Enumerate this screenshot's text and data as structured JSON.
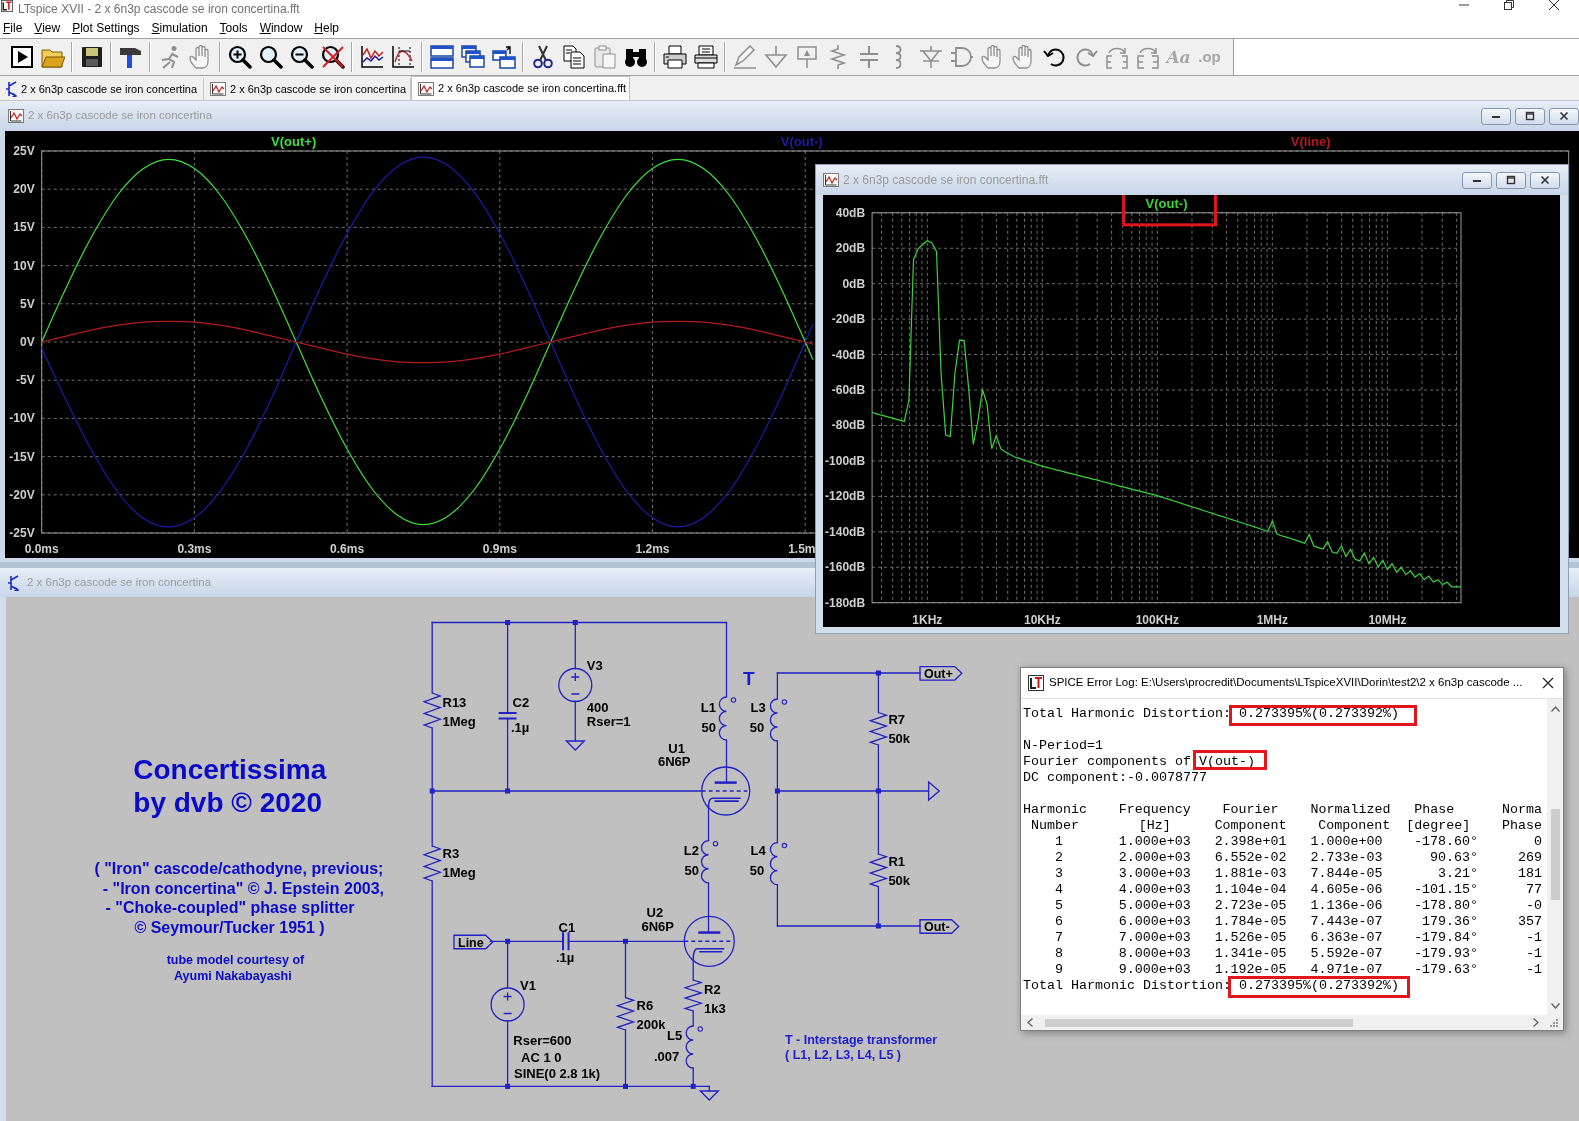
{
  "app_title": "LTspice XVII - 2 x 6n3p cascode se iron concertina.fft",
  "menu": [
    "File",
    "View",
    "Plot Settings",
    "Simulation",
    "Tools",
    "Window",
    "Help"
  ],
  "toolbar": [
    [
      {
        "kind": "run",
        "disabled": false
      },
      {
        "kind": "open",
        "disabled": false
      }
    ],
    [
      {
        "kind": "save",
        "disabled": false
      }
    ],
    [
      {
        "kind": "hammer",
        "disabled": false
      }
    ],
    [
      {
        "kind": "halt",
        "disabled": true
      },
      {
        "kind": "pan",
        "disabled": true
      }
    ],
    [
      {
        "kind": "zoom_in",
        "disabled": false
      },
      {
        "kind": "zoom_fit",
        "disabled": false
      },
      {
        "kind": "zoom_out",
        "disabled": false
      },
      {
        "kind": "zoom_cancel",
        "disabled": false
      }
    ],
    [
      {
        "kind": "autorange",
        "disabled": false
      },
      {
        "kind": "mark",
        "disabled": false
      }
    ],
    [
      {
        "kind": "tile",
        "disabled": false
      },
      {
        "kind": "cascade",
        "disabled": false
      },
      {
        "kind": "arrange",
        "disabled": false
      }
    ],
    [
      {
        "kind": "cut",
        "disabled": false
      },
      {
        "kind": "copy",
        "disabled": false
      },
      {
        "kind": "paste",
        "disabled": true
      },
      {
        "kind": "find",
        "disabled": false
      }
    ],
    [
      {
        "kind": "print",
        "disabled": false
      },
      {
        "kind": "print_setup",
        "disabled": false
      }
    ],
    [
      {
        "kind": "wire",
        "disabled": true
      },
      {
        "kind": "ground",
        "disabled": true
      },
      {
        "kind": "label",
        "disabled": true
      },
      {
        "kind": "resistor",
        "disabled": true
      },
      {
        "kind": "capacitor",
        "disabled": true
      },
      {
        "kind": "inductor",
        "disabled": true
      },
      {
        "kind": "diode",
        "disabled": true
      },
      {
        "kind": "component",
        "disabled": true
      },
      {
        "kind": "move",
        "disabled": true
      },
      {
        "kind": "drag",
        "disabled": true
      },
      {
        "kind": "undo",
        "disabled": false
      },
      {
        "kind": "redo",
        "disabled": true
      },
      {
        "kind": "rotate",
        "disabled": true
      },
      {
        "kind": "mirror",
        "disabled": true
      },
      {
        "kind": "text",
        "glyph": "Aa",
        "disabled": true
      },
      {
        "kind": "spice",
        "glyph": ".op",
        "disabled": true
      }
    ]
  ],
  "tabs": [
    {
      "kind": "schematic",
      "label": "2 x 6n3p cascode se iron concertina",
      "selected": false
    },
    {
      "kind": "waveform",
      "label": "2 x 6n3p cascode se iron concertina",
      "selected": false
    },
    {
      "kind": "waveform",
      "label": "2 x 6n3p cascode se iron concertina.fft",
      "selected": true
    }
  ],
  "waveform_window": {
    "title": "2 x 6n3p cascode se iron concertina",
    "chart_data": {
      "type": "line",
      "grid": true,
      "x": [
        0,
        0.05,
        0.1,
        0.15,
        0.2,
        0.25,
        0.3,
        0.35,
        0.4,
        0.45,
        0.5,
        0.55,
        0.6,
        0.65,
        0.7,
        0.75,
        0.8,
        0.85,
        0.9,
        0.95,
        1,
        1.05,
        1.1,
        1.15,
        1.2,
        1.25,
        1.3,
        1.35,
        1.4,
        1.45,
        1.5,
        1.515
      ],
      "series": [
        {
          "name": "V(out+)",
          "color": "#3ee03e",
          "values": [
            0,
            7.4,
            14,
            19.3,
            22.7,
            23.9,
            22.7,
            19.3,
            14,
            7.4,
            0,
            -7.4,
            -14,
            -19.3,
            -22.7,
            -23.9,
            -22.7,
            -19.3,
            -14,
            -7.4,
            0,
            7.4,
            14,
            19.3,
            22.7,
            23.9,
            22.7,
            19.3,
            14,
            7.4,
            0,
            -2.3
          ]
        },
        {
          "name": "V(out-)",
          "color": "#1c1ca8",
          "values": [
            -0.8,
            -7.9,
            -14.4,
            -19.7,
            -23.1,
            -24.2,
            -23,
            -19.6,
            -14.3,
            -7.6,
            0,
            7.5,
            14.2,
            19.6,
            23,
            24.2,
            23,
            19.6,
            14.2,
            7.5,
            0,
            -7.5,
            -14.2,
            -19.6,
            -23,
            -24.2,
            -23,
            -19.6,
            -14.2,
            -7.5,
            0,
            2.3
          ]
        },
        {
          "name": "V(line)",
          "color": "#b41c1c",
          "values": [
            0,
            0.8,
            1.6,
            2.2,
            2.6,
            2.7,
            2.6,
            2.2,
            1.6,
            0.8,
            0,
            -0.8,
            -1.6,
            -2.2,
            -2.6,
            -2.7,
            -2.6,
            -2.2,
            -1.6,
            -0.8,
            0,
            0.8,
            1.6,
            2.2,
            2.6,
            2.7,
            2.6,
            2.2,
            1.6,
            0.8,
            0,
            -0.3
          ]
        }
      ],
      "xlim": [
        0,
        3
      ],
      "ylim": [
        -25,
        25
      ],
      "xticks": [
        {
          "value": 0,
          "label": "0.0ms"
        },
        {
          "value": 0.3,
          "label": "0.3ms"
        },
        {
          "value": 0.6,
          "label": "0.6ms"
        },
        {
          "value": 0.9,
          "label": "0.9ms"
        },
        {
          "value": 1.2,
          "label": "1.2ms"
        },
        {
          "value": 1.5,
          "label": "1.5m"
        }
      ],
      "yticks": [
        {
          "value": 25,
          "label": "25V"
        },
        {
          "value": 20,
          "label": "20V"
        },
        {
          "value": 15,
          "label": "15V"
        },
        {
          "value": 10,
          "label": "10V"
        },
        {
          "value": 5,
          "label": "5V"
        },
        {
          "value": 0,
          "label": "0V"
        },
        {
          "value": -5,
          "label": "-5V"
        },
        {
          "value": -10,
          "label": "-10V"
        },
        {
          "value": -15,
          "label": "-15V"
        },
        {
          "value": -20,
          "label": "-20V"
        },
        {
          "value": -25,
          "label": "-25V"
        }
      ]
    }
  },
  "fft_window": {
    "title": "2 x 6n3p cascode se iron concertina.fft",
    "label_highlighted": true,
    "chart_data": {
      "type": "line",
      "grid": true,
      "categories": [
        null,
        null,
        null,
        null,
        null,
        null,
        null,
        null,
        null,
        null,
        null,
        null,
        "1KHz",
        null,
        null,
        null,
        null,
        null,
        null,
        null,
        null,
        null,
        null,
        null,
        null,
        null,
        null,
        null,
        null,
        null,
        null,
        null,
        null,
        null,
        null,
        null,
        null,
        "10KHz",
        null,
        null,
        null,
        null,
        null,
        null,
        null,
        null,
        null,
        null,
        null,
        null,
        null,
        null,
        null,
        null,
        null,
        null,
        null,
        null,
        null,
        null,
        null,
        null,
        "100KHz",
        null,
        null,
        null,
        null,
        null,
        null,
        null,
        null,
        null,
        null,
        null,
        null,
        null,
        null,
        null,
        null,
        null,
        null,
        null,
        null,
        null,
        null,
        null,
        null,
        "1MHz",
        null,
        null,
        null,
        null,
        null,
        null,
        null,
        null,
        null,
        null,
        null,
        null,
        null,
        null,
        null,
        null,
        null,
        null,
        null,
        null,
        null,
        null,
        null,
        null,
        "10MHz",
        null,
        null,
        null,
        null,
        null,
        null,
        null,
        null,
        null,
        null,
        null,
        null,
        null,
        null,
        null,
        null
      ],
      "series": [
        {
          "name": "V(out-)",
          "color": "#3ad43a",
          "values": [
            -72.7,
            -73.4,
            -74.2,
            -74.9,
            -75.6,
            -76.3,
            -77,
            -77.7,
            -65.8,
            13.5,
            19.7,
            22.1,
            24.2,
            23,
            18.2,
            -50.6,
            -85.4,
            -86.2,
            -50.8,
            -31.9,
            -32.1,
            -59.3,
            -90.7,
            -77.5,
            -59.6,
            -68.2,
            -93.1,
            -85.9,
            -93.2,
            -94.9,
            -96.4,
            -97.8,
            -98.6,
            -99.5,
            -100.4,
            -101.2,
            -102.1,
            -103,
            -103.6,
            -104.3,
            -105,
            -105.6,
            -106.3,
            -107,
            -107.6,
            -108.3,
            -109,
            -109.6,
            -110.3,
            -110.9,
            -111.6,
            -112.3,
            -112.9,
            -113.6,
            -114.3,
            -114.9,
            -115.6,
            -116.3,
            -116.9,
            -117.6,
            -118.3,
            -118.9,
            -119.6,
            -120.4,
            -121.3,
            -122.1,
            -122.9,
            -123.8,
            -124.6,
            -125.5,
            -126.3,
            -127.1,
            -128,
            -128.8,
            -129.6,
            -130.5,
            -131.3,
            -132.1,
            -133,
            -133.8,
            -134.6,
            -135.5,
            -136.3,
            -137.2,
            -138,
            -138.8,
            -139.7,
            -134,
            -141.3,
            -142.2,
            -143,
            -143.8,
            -144.7,
            -145.5,
            -146.4,
            -141.5,
            -148,
            -148.9,
            -149.7,
            -145.5,
            -151.4,
            -152.2,
            -148,
            -153.9,
            -150,
            -155.5,
            -156.4,
            -152,
            -158.1,
            -154.5,
            -159.8,
            -156,
            -161.4,
            -158,
            -162.8,
            -160,
            -164.2,
            -162,
            -165.6,
            -163.5,
            -167,
            -165,
            -168.4,
            -167,
            -169.8,
            -168.5,
            -171.1,
            -171.1,
            -171.1
          ]
        }
      ],
      "ylim": [
        -180,
        40
      ],
      "yticks": [
        {
          "value": 40,
          "label": "40dB"
        },
        {
          "value": 20,
          "label": "20dB"
        },
        {
          "value": 0,
          "label": "0dB"
        },
        {
          "value": -20,
          "label": "-20dB"
        },
        {
          "value": -40,
          "label": "-40dB"
        },
        {
          "value": -60,
          "label": "-60dB"
        },
        {
          "value": -80,
          "label": "-80dB"
        },
        {
          "value": -100,
          "label": "-100dB"
        },
        {
          "value": -120,
          "label": "-120dB"
        },
        {
          "value": -140,
          "label": "-140dB"
        },
        {
          "value": -160,
          "label": "-160dB"
        },
        {
          "value": -180,
          "label": "-180dB"
        }
      ]
    }
  },
  "schematic_window": {
    "title": "2 x 6n3p cascode se iron concertina",
    "components": [
      {
        "kind": "resistor",
        "ref": "R13",
        "lines": [
          "1Meg"
        ]
      },
      {
        "kind": "capacitor",
        "ref": "C2",
        "lines": [
          ".1µ"
        ]
      },
      {
        "kind": "voltage_source",
        "ref": "V3",
        "lines": [
          "400",
          "Rser=1"
        ]
      },
      {
        "kind": "inductor",
        "ref": "L1",
        "lines": [
          "50"
        ]
      },
      {
        "kind": "tube",
        "ref": "U1",
        "lines": [
          "6N6P"
        ]
      },
      {
        "kind": "inductor",
        "ref": "L3",
        "lines": [
          "50"
        ]
      },
      {
        "kind": "resistor",
        "ref": "R7",
        "lines": [
          "50k"
        ]
      },
      {
        "kind": "resistor",
        "ref": "R3",
        "lines": [
          "1Meg"
        ]
      },
      {
        "kind": "inductor",
        "ref": "L2",
        "lines": [
          "50"
        ]
      },
      {
        "kind": "inductor",
        "ref": "L4",
        "lines": [
          "50"
        ]
      },
      {
        "kind": "resistor",
        "ref": "R1",
        "lines": [
          "50k"
        ]
      },
      {
        "kind": "tube",
        "ref": "U2",
        "lines": [
          "6N6P"
        ]
      },
      {
        "kind": "capacitor",
        "ref": "C1",
        "lines": [
          ".1µ"
        ]
      },
      {
        "kind": "voltage_source",
        "ref": "V1",
        "lines": [
          "Rser=600",
          "AC 1 0",
          "SINE(0 2.8 1k)"
        ]
      },
      {
        "kind": "resistor",
        "ref": "R6",
        "lines": [
          "200k"
        ]
      },
      {
        "kind": "resistor",
        "ref": "R2",
        "lines": [
          "1k3"
        ]
      },
      {
        "kind": "inductor",
        "ref": "L5",
        "lines": [
          ".007"
        ]
      }
    ],
    "net_labels": [
      "Out+",
      "Out-",
      "Line"
    ],
    "transformer_mark": "T",
    "title_lines": [
      "Concertissima",
      "by dvb © 2020"
    ],
    "history_lines": [
      "( \"Iron\" cascode/cathodyne, previous;",
      "- \"Iron concertina\" © J. Epstein 2003,",
      "- \"Choke-coupled\" phase splitter",
      "© Seymour/Tucker 1951 )"
    ],
    "credit_lines": [
      "tube model courtesy of",
      "Ayumi Nakabayashi"
    ],
    "legend_lines": [
      "T - Interstage transformer",
      "( L1, L2, L3, L4, L5 )"
    ]
  },
  "error_log": {
    "title": "SPICE Error Log: E:\\Users\\procredit\\Documents\\LTspiceXVII\\Dorin\\test2\\2 x 6n3p cascode ...",
    "thd_top": {
      "label": "Total Harmonic Distortion:",
      "value": "0.273395%(0.273392%)",
      "highlighted": true
    },
    "n_period": "N-Period=1",
    "fourier_of": {
      "label": "Fourier components of",
      "value": "V(out-)",
      "highlighted": true
    },
    "dc_component": "DC component:-0.0078777",
    "table": {
      "header": [
        [
          "Harmonic",
          "Frequency",
          "Fourier",
          "Normalized",
          "Phase",
          "Norma"
        ],
        [
          "Number",
          "[Hz]",
          "Component",
          "Component",
          "[degree]",
          "Phase"
        ]
      ],
      "rows": [
        [
          "1",
          "1.000e+03",
          "2.398e+01",
          "1.000e+00",
          "-178.60°",
          "0"
        ],
        [
          "2",
          "2.000e+03",
          "6.552e-02",
          "2.733e-03",
          "90.63°",
          "269"
        ],
        [
          "3",
          "3.000e+03",
          "1.881e-03",
          "7.844e-05",
          "3.21°",
          "181"
        ],
        [
          "4",
          "4.000e+03",
          "1.104e-04",
          "4.605e-06",
          "-101.15°",
          "77"
        ],
        [
          "5",
          "5.000e+03",
          "2.723e-05",
          "1.136e-06",
          "-178.80°",
          "-0"
        ],
        [
          "6",
          "6.000e+03",
          "1.784e-05",
          "7.443e-07",
          "179.36°",
          "357"
        ],
        [
          "7",
          "7.000e+03",
          "1.526e-05",
          "6.363e-07",
          "-179.84°",
          "-1"
        ],
        [
          "8",
          "8.000e+03",
          "1.341e-05",
          "5.592e-07",
          "-179.93°",
          "-1"
        ],
        [
          "9",
          "9.000e+03",
          "1.192e-05",
          "4.971e-07",
          "-179.63°",
          "-1"
        ]
      ]
    },
    "thd_bottom": {
      "label": "Total Harmonic Distortion:",
      "value": "0.273395%(0.273392%)",
      "highlighted": true
    }
  }
}
